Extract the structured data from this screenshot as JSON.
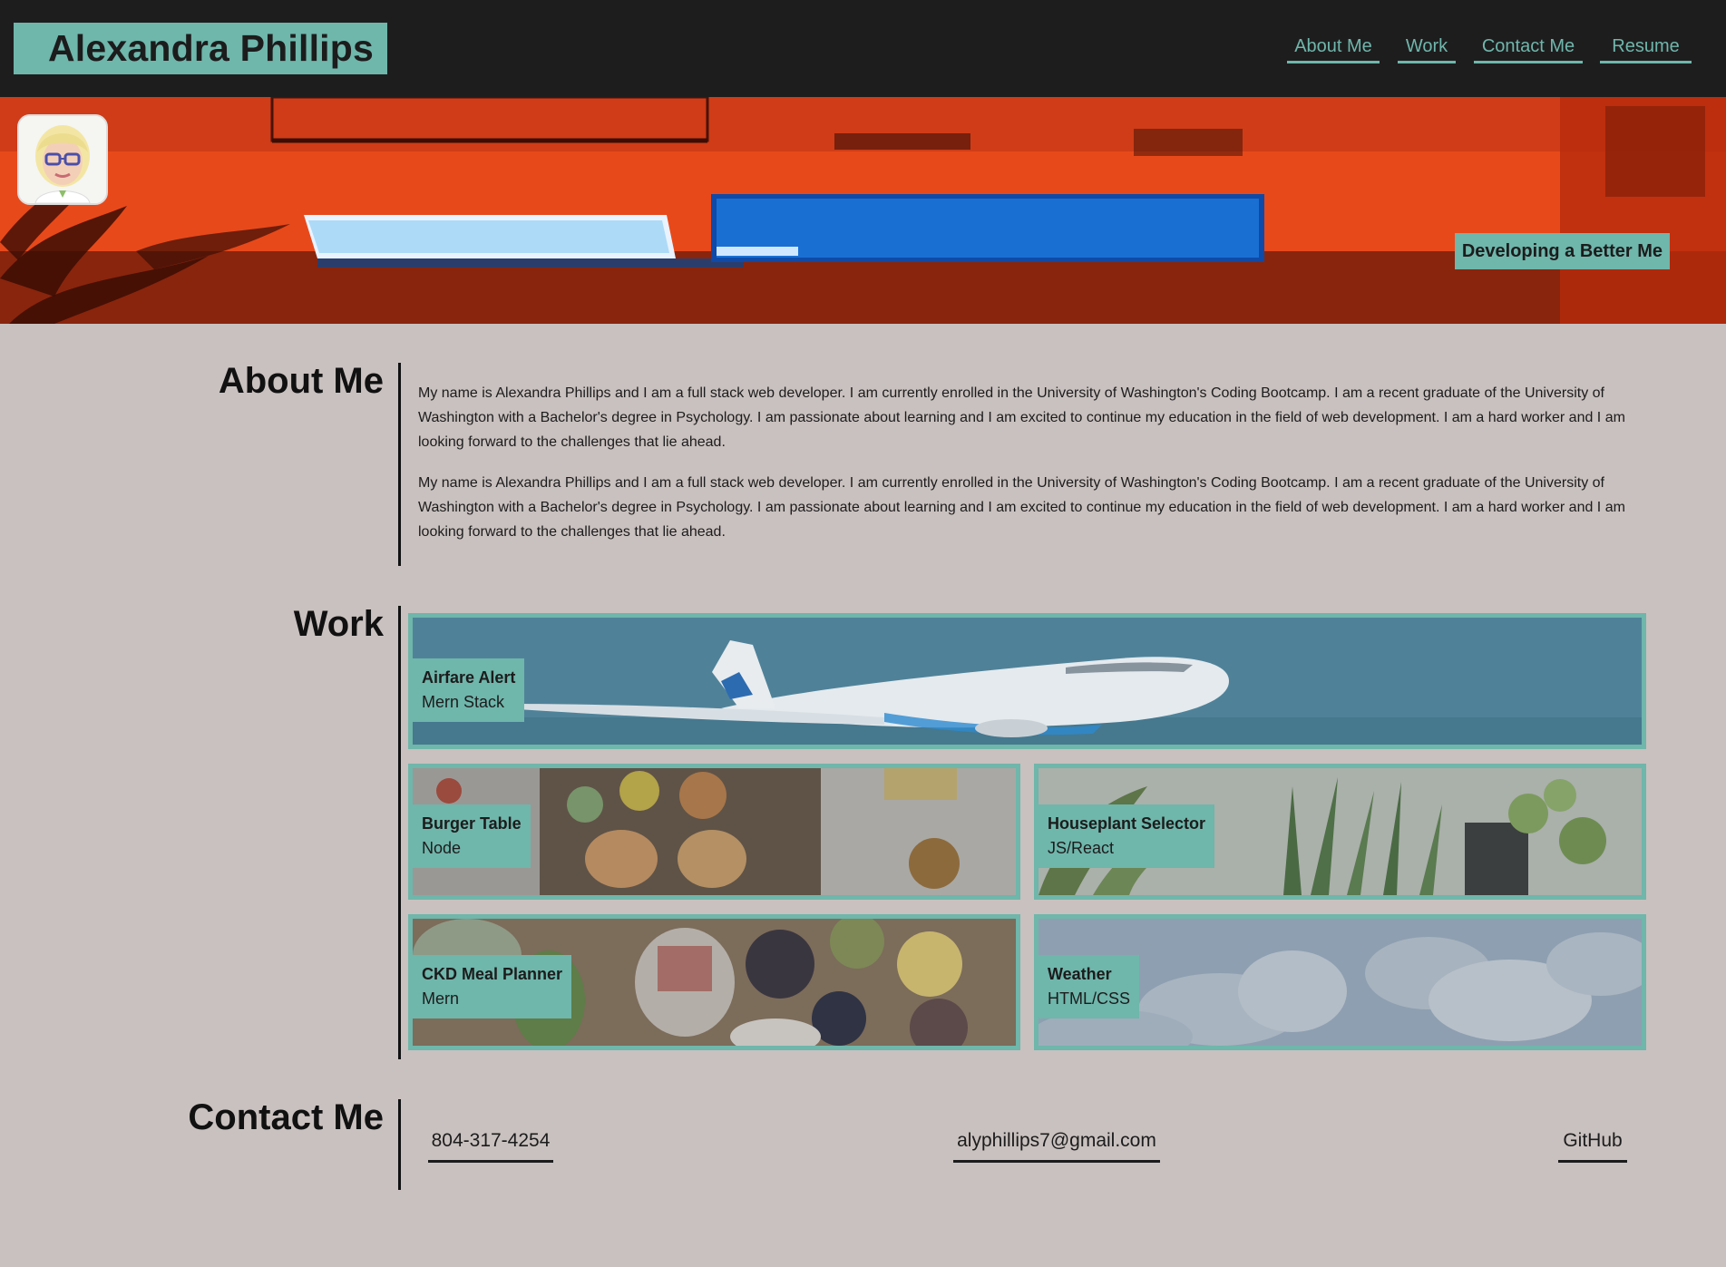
{
  "header": {
    "title": "Alexandra Phillips",
    "nav": [
      {
        "label": "About Me"
      },
      {
        "label": "Work"
      },
      {
        "label": "Contact Me"
      },
      {
        "label": "Resume"
      }
    ]
  },
  "hero": {
    "tagline": "Developing a Better Me"
  },
  "about": {
    "heading": "About Me",
    "paragraphs": [
      "My name is Alexandra Phillips and I am a full stack web developer. I am currently enrolled in the University of Washington's Coding Bootcamp. I am a recent graduate of the University of Washington with a Bachelor's degree in Psychology. I am passionate about learning and I am excited to continue my education in the field of web development. I am a hard worker and I am looking forward to the challenges that lie ahead.",
      "My name is Alexandra Phillips and I am a full stack web developer. I am currently enrolled in the University of Washington's Coding Bootcamp. I am a recent graduate of the University of Washington with a Bachelor's degree in Psychology. I am passionate about learning and I am excited to continue my education in the field of web development. I am a hard worker and I am looking forward to the challenges that lie ahead."
    ]
  },
  "work": {
    "heading": "Work",
    "projects": [
      {
        "title": "Airfare Alert",
        "stack": "Mern Stack"
      },
      {
        "title": "Burger Table",
        "stack": "Node"
      },
      {
        "title": "Houseplant Selector",
        "stack": "JS/React"
      },
      {
        "title": "CKD Meal Planner",
        "stack": "Mern"
      },
      {
        "title": "Weather",
        "stack": "HTML/CSS"
      }
    ]
  },
  "contact": {
    "heading": "Contact Me",
    "phone": "804-317-4254",
    "email": "alyphillips7@gmail.com",
    "github": "GitHub"
  },
  "colors": {
    "accent": "#6fb6ab",
    "background": "#c9c1bf",
    "header": "#1e1d1e"
  }
}
